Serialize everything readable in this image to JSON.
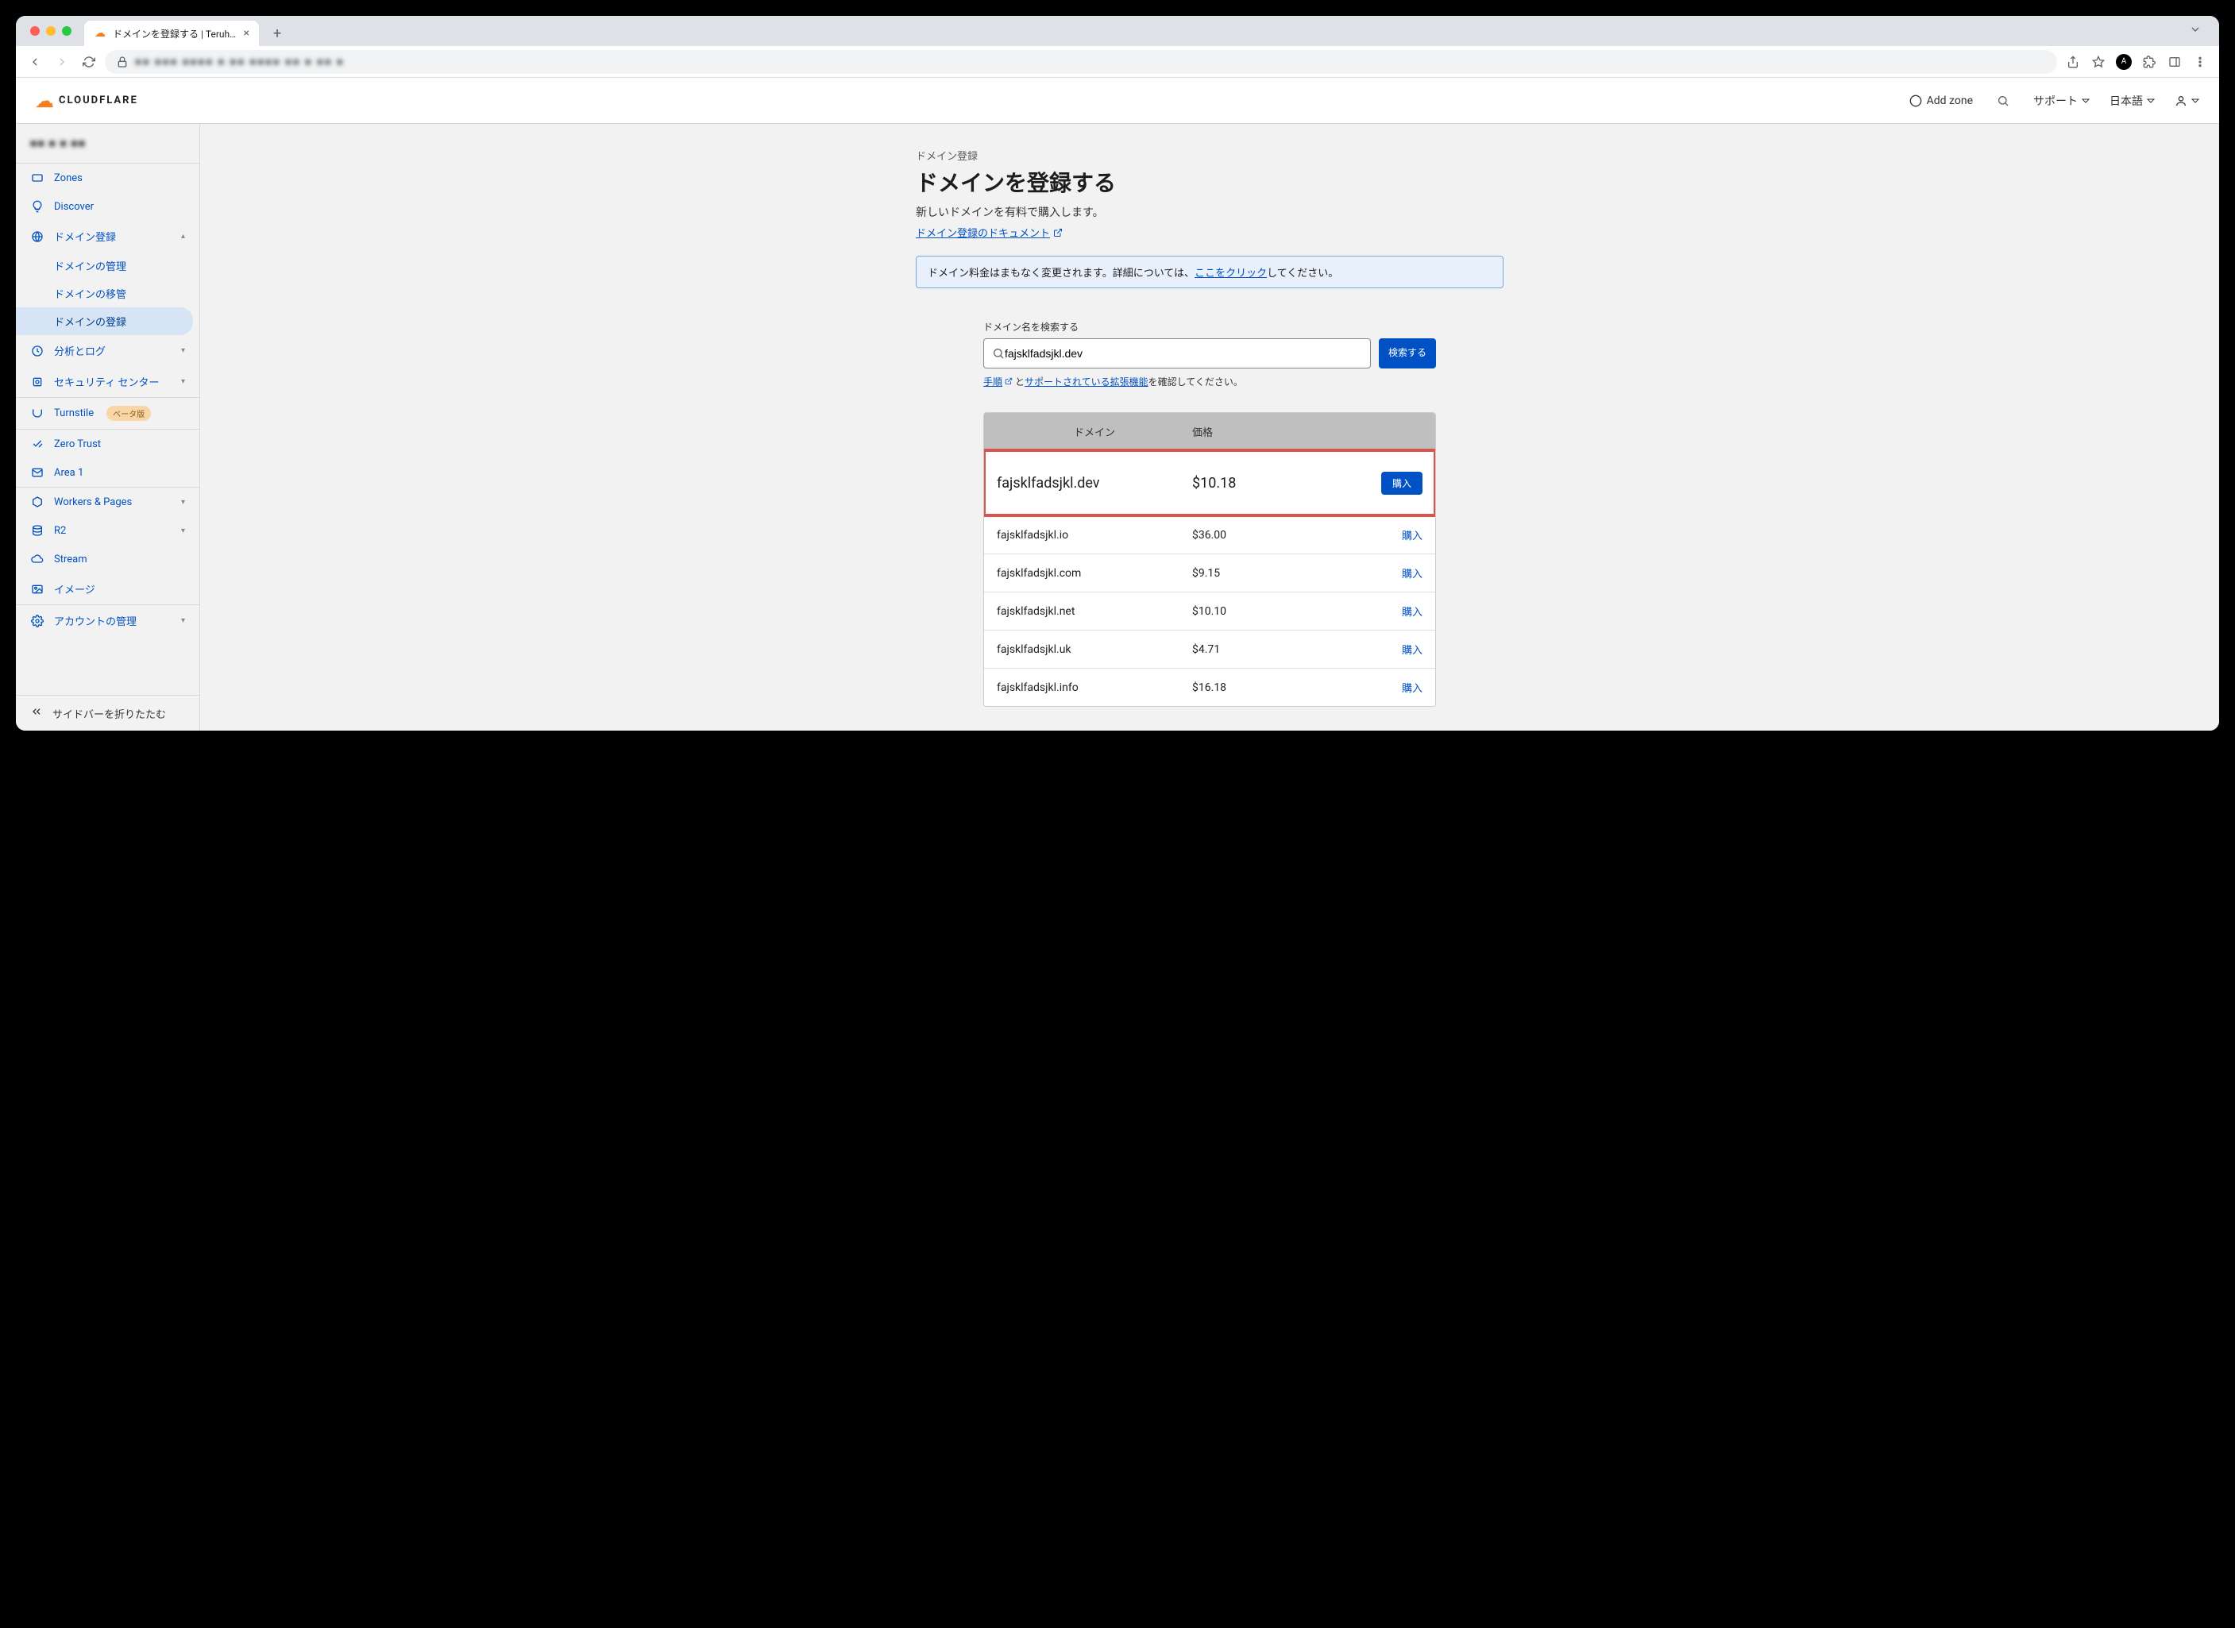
{
  "browser": {
    "tab_title": "ドメインを登録する | Teruhiro Ko...",
    "new_tab": "+"
  },
  "header": {
    "logo_text": "CLOUDFLARE",
    "add_zone": "Add zone",
    "support": "サポート",
    "language": "日本語"
  },
  "sidebar": {
    "zones": "Zones",
    "discover": "Discover",
    "domain_reg": "ドメイン登録",
    "domain_manage": "ドメインの管理",
    "domain_transfer": "ドメインの移管",
    "domain_register": "ドメインの登録",
    "analytics": "分析とログ",
    "security": "セキュリティ センター",
    "turnstile": "Turnstile",
    "turnstile_badge": "ベータ版",
    "zero_trust": "Zero Trust",
    "area1": "Area 1",
    "workers": "Workers & Pages",
    "r2": "R2",
    "stream": "Stream",
    "images": "イメージ",
    "account_mgmt": "アカウントの管理",
    "collapse": "サイドバーを折りたたむ"
  },
  "page": {
    "breadcrumb": "ドメイン登録",
    "title": "ドメインを登録する",
    "description": "新しいドメインを有料で購入します。",
    "doc_link": "ドメイン登録のドキュメント",
    "banner_prefix": "ドメイン料金はまもなく変更されます。詳細については、",
    "banner_link": "ここをクリック",
    "banner_suffix": "してください。"
  },
  "search": {
    "label": "ドメイン名を検索する",
    "value": "fajsklfadsjkl.dev",
    "button": "検索する",
    "help_instructions": "手順",
    "help_and": "と",
    "help_supported": "サポートされている拡張機能",
    "help_suffix": "を確認してください。"
  },
  "results": {
    "col_domain": "ドメイン",
    "col_price": "価格",
    "buy_label": "購入",
    "rows": [
      {
        "domain": "fajsklfadsjkl.dev",
        "price": "$10.18",
        "highlighted": true
      },
      {
        "domain": "fajsklfadsjkl.io",
        "price": "$36.00",
        "highlighted": false
      },
      {
        "domain": "fajsklfadsjkl.com",
        "price": "$9.15",
        "highlighted": false
      },
      {
        "domain": "fajsklfadsjkl.net",
        "price": "$10.10",
        "highlighted": false
      },
      {
        "domain": "fajsklfadsjkl.uk",
        "price": "$4.71",
        "highlighted": false
      },
      {
        "domain": "fajsklfadsjkl.info",
        "price": "$16.18",
        "highlighted": false
      }
    ]
  }
}
